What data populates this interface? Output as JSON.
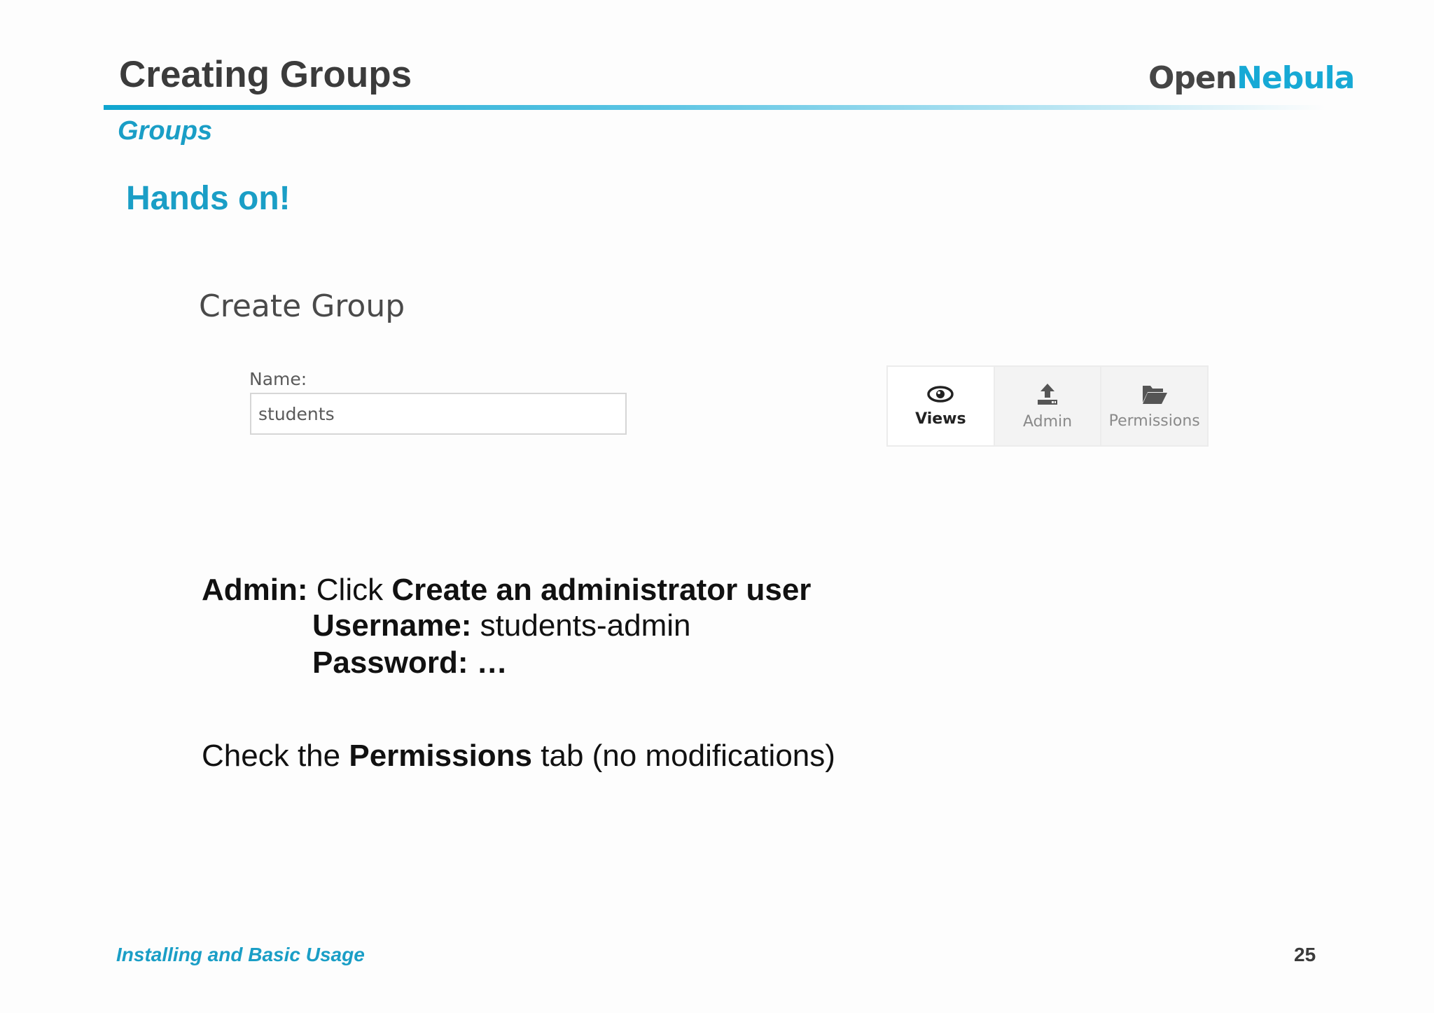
{
  "slide": {
    "title": "Creating Groups",
    "subtitle": "Groups",
    "heading": "Hands on!",
    "logo": {
      "part1": "Open",
      "part2": "Nebula"
    }
  },
  "screenshot": {
    "panel_title": "Create Group",
    "name_label": "Name:",
    "name_value": "students",
    "tabs": [
      {
        "label": "Views",
        "icon": "eye-icon",
        "active": true
      },
      {
        "label": "Admin",
        "icon": "upload-icon",
        "active": false
      },
      {
        "label": "Permissions",
        "icon": "folder-open-icon",
        "active": false
      }
    ]
  },
  "instructions": {
    "admin_label": "Admin:",
    "admin_click": "Click",
    "admin_action": "Create an administrator user",
    "username_label": "Username:",
    "username_value": "students-admin",
    "password_label": "Password: …",
    "check_prefix": "Check the",
    "check_bold": "Permissions",
    "check_suffix": "tab (no modifications)"
  },
  "footer": {
    "left": "Installing and Basic Usage",
    "page": "25"
  },
  "colors": {
    "accent": "#1a9ec6",
    "title": "#3b3b3b"
  }
}
